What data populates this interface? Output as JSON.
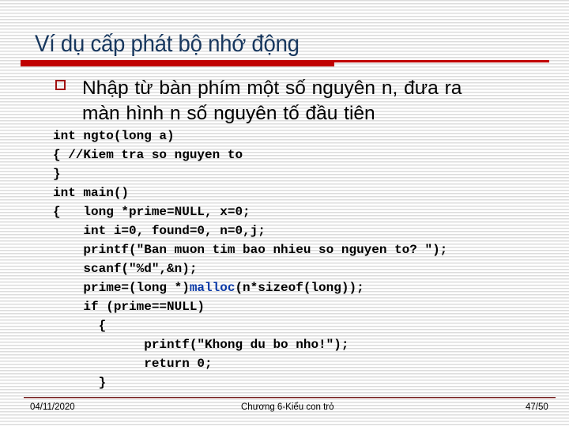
{
  "slide": {
    "title": "Ví dụ cấp phát bộ nhớ động",
    "bullet": {
      "icon": "hollow-square-bullet-icon",
      "line1": "Nhập từ bàn phím một số nguyên n, đưa ra",
      "line2": "màn hình n số nguyên tố đầu tiên"
    },
    "code_lines": [
      {
        "indent": "",
        "pre": "int ngto(long a)",
        "fn": "",
        "post": ""
      },
      {
        "indent": "",
        "pre": "{ //Kiem tra so nguyen to",
        "fn": "",
        "post": ""
      },
      {
        "indent": "",
        "pre": "}",
        "fn": "",
        "post": ""
      },
      {
        "indent": "",
        "pre": "int main()",
        "fn": "",
        "post": ""
      },
      {
        "indent": "",
        "pre": "{   long *prime=NULL, x=0;",
        "fn": "",
        "post": ""
      },
      {
        "indent": "    ",
        "pre": "int i=0, found=0, n=0,j;",
        "fn": "",
        "post": ""
      },
      {
        "indent": "    ",
        "pre": "printf(\"Ban muon tim bao nhieu so nguyen to? \");",
        "fn": "",
        "post": ""
      },
      {
        "indent": "    ",
        "pre": "scanf(\"%d\",&n);",
        "fn": "",
        "post": ""
      },
      {
        "indent": "    ",
        "pre": "prime=(long *)",
        "fn": "malloc",
        "post": "(n*sizeof(long));"
      },
      {
        "indent": "    ",
        "pre": "if (prime==NULL)",
        "fn": "",
        "post": ""
      },
      {
        "indent": "      ",
        "pre": "{",
        "fn": "",
        "post": ""
      },
      {
        "indent": "            ",
        "pre": "printf(\"Khong du bo nho!\");",
        "fn": "",
        "post": ""
      },
      {
        "indent": "            ",
        "pre": "return 0;",
        "fn": "",
        "post": ""
      },
      {
        "indent": "      ",
        "pre": "}",
        "fn": "",
        "post": ""
      }
    ],
    "highlight_color": "#0b3aa8",
    "accent_color": "#c00000"
  },
  "footer": {
    "date": "04/11/2020",
    "chapter": "Chương 6-Kiểu con trỏ",
    "page": "47/50"
  }
}
